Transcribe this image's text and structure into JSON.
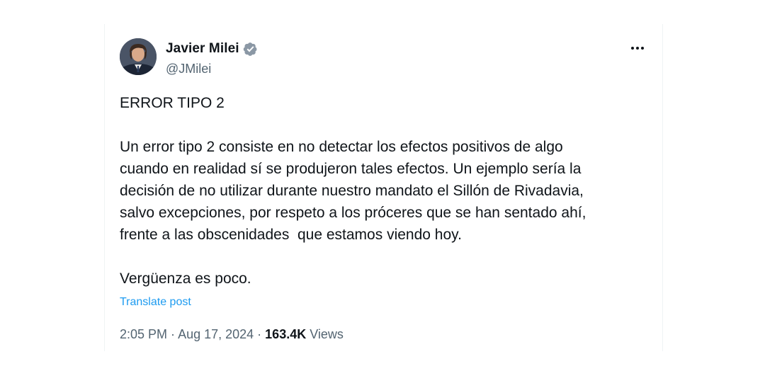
{
  "author": {
    "display_name": "Javier Milei",
    "handle": "@JMilei",
    "avatar_icon": "profile-photo",
    "verified_icon": "verified-badge-icon",
    "verified_color": "#8b98a5"
  },
  "post": {
    "title_line": "ERROR TIPO 2",
    "main_lines": [
      "Un error tipo 2 consiste en no detectar los efectos positivos de algo",
      "cuando en realidad sí se produjeron tales efectos. Un ejemplo sería la",
      "decisión de no utilizar durante nuestro mandato el Sillón de Rivadavia,",
      "salvo excepciones, por respeto a los próceres que se han sentado ahí,",
      "frente a las obscenidades  que estamos viendo hoy."
    ],
    "closing_line": "Vergüenza es poco.",
    "translate_label": "Translate post"
  },
  "meta": {
    "time": "2:05 PM",
    "separator": " · ",
    "date": "Aug 17, 2024",
    "views_count": "163.4K",
    "views_label": " Views"
  },
  "more_icon": "more-dots-icon",
  "accent_color": "#1d9bf0"
}
